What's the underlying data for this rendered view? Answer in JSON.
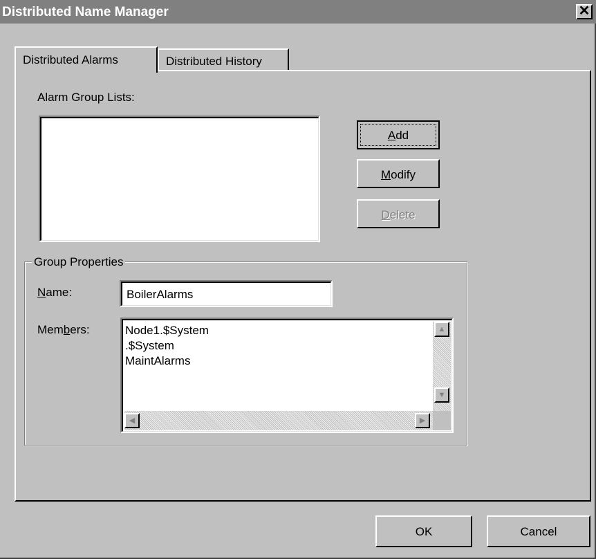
{
  "window": {
    "title": "Distributed Name Manager",
    "close_glyph": "✕"
  },
  "tabs": [
    {
      "label": "Distributed Alarms",
      "active": true
    },
    {
      "label": "Distributed History",
      "active": false
    }
  ],
  "alarm_group_lists": {
    "label": "Alarm Group Lists:",
    "items": []
  },
  "buttons": {
    "add": {
      "pre": "",
      "mnemonic": "A",
      "post": "dd",
      "enabled": true,
      "default": true
    },
    "modify": {
      "pre": "",
      "mnemonic": "M",
      "post": "odify",
      "enabled": true
    },
    "delete": {
      "pre": "",
      "mnemonic": "D",
      "post": "elete",
      "enabled": false
    },
    "ok": {
      "label": "OK"
    },
    "cancel": {
      "label": "Cancel"
    }
  },
  "group_properties": {
    "legend": "Group Properties",
    "name_label": {
      "pre": "",
      "mnemonic": "N",
      "post": "ame:"
    },
    "name_value": "BoilerAlarms",
    "members_label": {
      "pre": "Mem",
      "mnemonic": "b",
      "post": "ers:"
    },
    "members": [
      "Node1.$System",
      ".$System",
      "MaintAlarms"
    ]
  },
  "icons": {
    "scroll_up": "▲",
    "scroll_down": "▼",
    "scroll_left": "◀",
    "scroll_right": "▶"
  }
}
